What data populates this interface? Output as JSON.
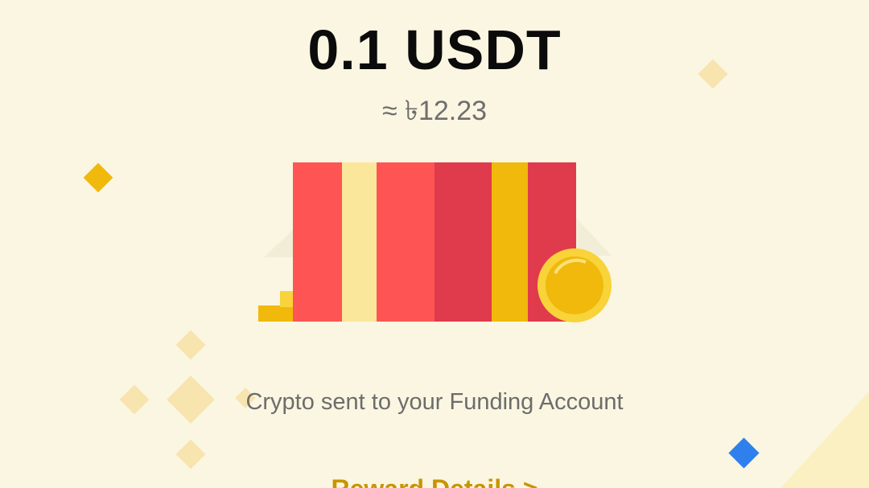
{
  "reward": {
    "amount": "0.1 USDT",
    "fiat_equivalent": "≈ ৳12.23",
    "message": "Crypto sent to your Funding Account",
    "details_link": "Reward Details >"
  },
  "colors": {
    "background": "#FAF6E1",
    "accent": "#C99400",
    "gift_red": "#FF5454",
    "gift_dark_red": "#E03A4D",
    "gift_yellow": "#F0B90B",
    "gift_ribbon_light": "#FBE79C",
    "diamond_blue": "#2F80ED"
  },
  "icons": {
    "gift": "red-packet-gift-icon",
    "coin": "gold-coin-icon"
  }
}
